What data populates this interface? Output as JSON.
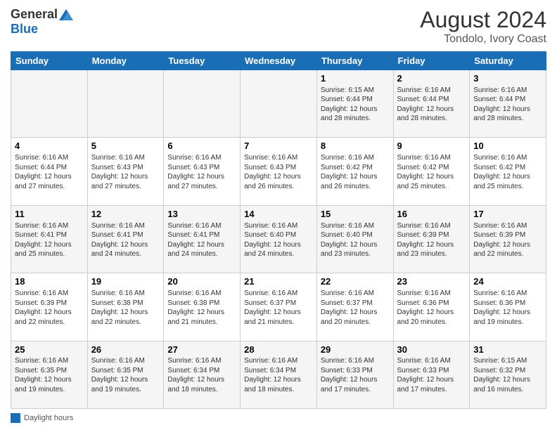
{
  "header": {
    "logo_general": "General",
    "logo_blue": "Blue",
    "month_year": "August 2024",
    "location": "Tondolo, Ivory Coast"
  },
  "legend": {
    "label": "Daylight hours"
  },
  "days_of_week": [
    "Sunday",
    "Monday",
    "Tuesday",
    "Wednesday",
    "Thursday",
    "Friday",
    "Saturday"
  ],
  "weeks": [
    [
      {
        "day": "",
        "info": ""
      },
      {
        "day": "",
        "info": ""
      },
      {
        "day": "",
        "info": ""
      },
      {
        "day": "",
        "info": ""
      },
      {
        "day": "1",
        "info": "Sunrise: 6:15 AM\nSunset: 6:44 PM\nDaylight: 12 hours and 28 minutes."
      },
      {
        "day": "2",
        "info": "Sunrise: 6:16 AM\nSunset: 6:44 PM\nDaylight: 12 hours and 28 minutes."
      },
      {
        "day": "3",
        "info": "Sunrise: 6:16 AM\nSunset: 6:44 PM\nDaylight: 12 hours and 28 minutes."
      }
    ],
    [
      {
        "day": "4",
        "info": "Sunrise: 6:16 AM\nSunset: 6:44 PM\nDaylight: 12 hours and 27 minutes."
      },
      {
        "day": "5",
        "info": "Sunrise: 6:16 AM\nSunset: 6:43 PM\nDaylight: 12 hours and 27 minutes."
      },
      {
        "day": "6",
        "info": "Sunrise: 6:16 AM\nSunset: 6:43 PM\nDaylight: 12 hours and 27 minutes."
      },
      {
        "day": "7",
        "info": "Sunrise: 6:16 AM\nSunset: 6:43 PM\nDaylight: 12 hours and 26 minutes."
      },
      {
        "day": "8",
        "info": "Sunrise: 6:16 AM\nSunset: 6:42 PM\nDaylight: 12 hours and 26 minutes."
      },
      {
        "day": "9",
        "info": "Sunrise: 6:16 AM\nSunset: 6:42 PM\nDaylight: 12 hours and 25 minutes."
      },
      {
        "day": "10",
        "info": "Sunrise: 6:16 AM\nSunset: 6:42 PM\nDaylight: 12 hours and 25 minutes."
      }
    ],
    [
      {
        "day": "11",
        "info": "Sunrise: 6:16 AM\nSunset: 6:41 PM\nDaylight: 12 hours and 25 minutes."
      },
      {
        "day": "12",
        "info": "Sunrise: 6:16 AM\nSunset: 6:41 PM\nDaylight: 12 hours and 24 minutes."
      },
      {
        "day": "13",
        "info": "Sunrise: 6:16 AM\nSunset: 6:41 PM\nDaylight: 12 hours and 24 minutes."
      },
      {
        "day": "14",
        "info": "Sunrise: 6:16 AM\nSunset: 6:40 PM\nDaylight: 12 hours and 24 minutes."
      },
      {
        "day": "15",
        "info": "Sunrise: 6:16 AM\nSunset: 6:40 PM\nDaylight: 12 hours and 23 minutes."
      },
      {
        "day": "16",
        "info": "Sunrise: 6:16 AM\nSunset: 6:39 PM\nDaylight: 12 hours and 23 minutes."
      },
      {
        "day": "17",
        "info": "Sunrise: 6:16 AM\nSunset: 6:39 PM\nDaylight: 12 hours and 22 minutes."
      }
    ],
    [
      {
        "day": "18",
        "info": "Sunrise: 6:16 AM\nSunset: 6:39 PM\nDaylight: 12 hours and 22 minutes."
      },
      {
        "day": "19",
        "info": "Sunrise: 6:16 AM\nSunset: 6:38 PM\nDaylight: 12 hours and 22 minutes."
      },
      {
        "day": "20",
        "info": "Sunrise: 6:16 AM\nSunset: 6:38 PM\nDaylight: 12 hours and 21 minutes."
      },
      {
        "day": "21",
        "info": "Sunrise: 6:16 AM\nSunset: 6:37 PM\nDaylight: 12 hours and 21 minutes."
      },
      {
        "day": "22",
        "info": "Sunrise: 6:16 AM\nSunset: 6:37 PM\nDaylight: 12 hours and 20 minutes."
      },
      {
        "day": "23",
        "info": "Sunrise: 6:16 AM\nSunset: 6:36 PM\nDaylight: 12 hours and 20 minutes."
      },
      {
        "day": "24",
        "info": "Sunrise: 6:16 AM\nSunset: 6:36 PM\nDaylight: 12 hours and 19 minutes."
      }
    ],
    [
      {
        "day": "25",
        "info": "Sunrise: 6:16 AM\nSunset: 6:35 PM\nDaylight: 12 hours and 19 minutes."
      },
      {
        "day": "26",
        "info": "Sunrise: 6:16 AM\nSunset: 6:35 PM\nDaylight: 12 hours and 19 minutes."
      },
      {
        "day": "27",
        "info": "Sunrise: 6:16 AM\nSunset: 6:34 PM\nDaylight: 12 hours and 18 minutes."
      },
      {
        "day": "28",
        "info": "Sunrise: 6:16 AM\nSunset: 6:34 PM\nDaylight: 12 hours and 18 minutes."
      },
      {
        "day": "29",
        "info": "Sunrise: 6:16 AM\nSunset: 6:33 PM\nDaylight: 12 hours and 17 minutes."
      },
      {
        "day": "30",
        "info": "Sunrise: 6:16 AM\nSunset: 6:33 PM\nDaylight: 12 hours and 17 minutes."
      },
      {
        "day": "31",
        "info": "Sunrise: 6:15 AM\nSunset: 6:32 PM\nDaylight: 12 hours and 16 minutes."
      }
    ]
  ]
}
